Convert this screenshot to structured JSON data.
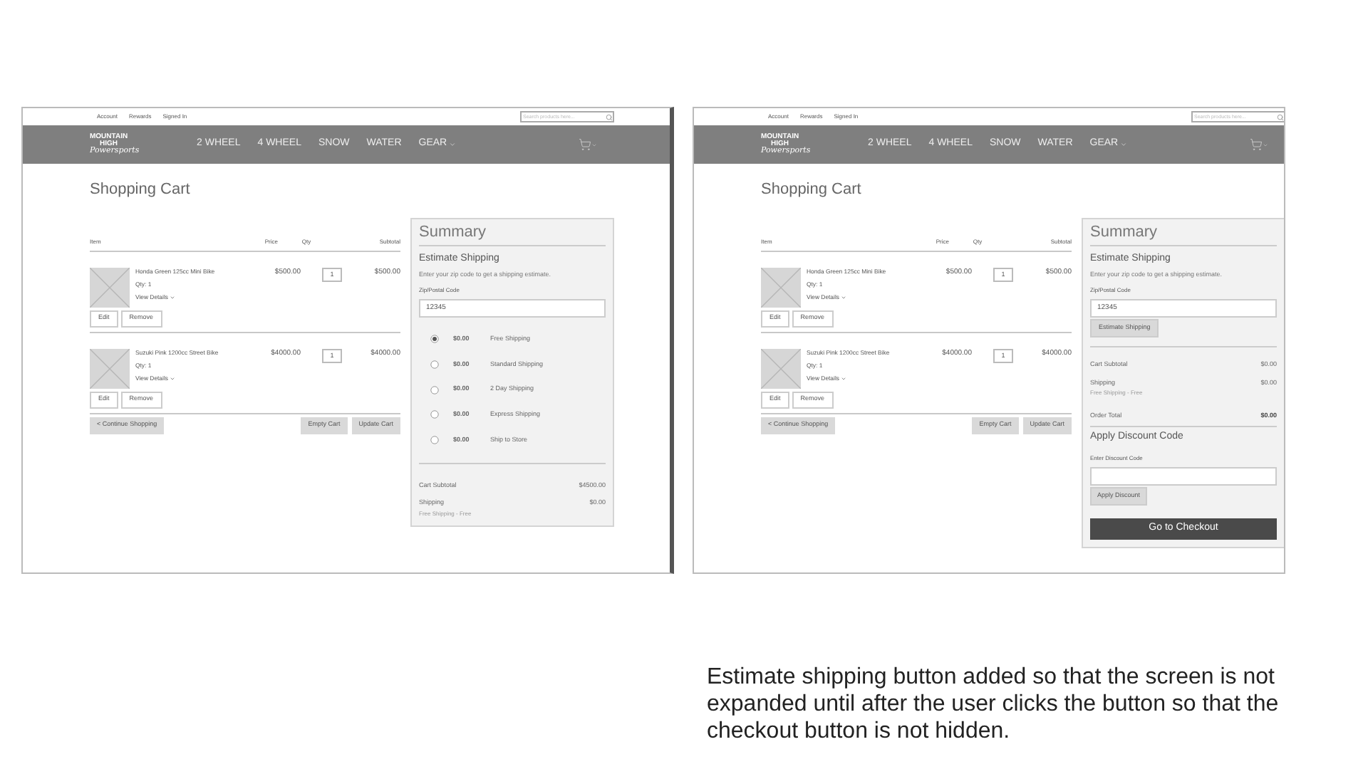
{
  "screens": [
    {
      "top_links": [
        "Account",
        "Rewards",
        "Signed In"
      ],
      "search": {
        "placeholder": "Search products here..."
      },
      "logo": [
        "MOUNTAIN",
        "HIGH",
        "Powersports"
      ],
      "nav": [
        {
          "label": "2 WHEEL",
          "dropdown": false
        },
        {
          "label": "4 WHEEL",
          "dropdown": false
        },
        {
          "label": "SNOW",
          "dropdown": false
        },
        {
          "label": "WATER",
          "dropdown": false
        },
        {
          "label": "GEAR",
          "dropdown": true
        }
      ],
      "page_title": "Shopping Cart",
      "columns": [
        "Item",
        "Price",
        "Qty",
        "Subtotal"
      ],
      "rows": [
        {
          "name": "Honda Green 125cc Mini Bike",
          "price": "$500.00",
          "qty": "1",
          "subtotal": "$500.00",
          "qty_line": "Qty: 1",
          "details": "View Details",
          "buttons": [
            "Edit",
            "Remove"
          ]
        },
        {
          "name": "Suzuki Pink 1200cc Street Bike",
          "price": "$4000.00",
          "qty": "1",
          "subtotal": "$4000.00",
          "qty_line": "Qty: 1",
          "details": "View Details",
          "buttons": [
            "Edit",
            "Remove"
          ]
        }
      ],
      "cart_buttons": [
        "< Continue Shopping",
        "Empty Cart",
        "Update Cart"
      ],
      "summary": {
        "kind": "options",
        "title": "Summary",
        "section": "Estimate Shipping",
        "hint": "Enter your zip code to get a shipping estimate.",
        "zip_label": "Zip/Postal Code",
        "zip_value": "12345",
        "options": [
          {
            "price": "$0.00",
            "label": "Free Shipping",
            "selected": true
          },
          {
            "price": "$0.00",
            "label": "Standard Shipping",
            "selected": false
          },
          {
            "price": "$0.00",
            "label": "2 Day Shipping",
            "selected": false
          },
          {
            "price": "$0.00",
            "label": "Express Shipping",
            "selected": false
          },
          {
            "price": "$0.00",
            "label": "Ship to Store",
            "selected": false
          }
        ],
        "totals": [
          {
            "kind": "line",
            "label": "Cart Subtotal",
            "value": "$4500.00"
          },
          {
            "kind": "line",
            "label": "Shipping",
            "note": "Free Shipping - Free",
            "value": "$0.00"
          }
        ]
      }
    },
    {
      "top_links": [
        "Account",
        "Rewards",
        "Signed In"
      ],
      "search": {
        "placeholder": "Search products here..."
      },
      "logo": [
        "MOUNTAIN",
        "HIGH",
        "Powersports"
      ],
      "nav": [
        {
          "label": "2 WHEEL",
          "dropdown": false
        },
        {
          "label": "4 WHEEL",
          "dropdown": false
        },
        {
          "label": "SNOW",
          "dropdown": false
        },
        {
          "label": "WATER",
          "dropdown": false
        },
        {
          "label": "GEAR",
          "dropdown": true
        }
      ],
      "page_title": "Shopping Cart",
      "columns": [
        "Item",
        "Price",
        "Qty",
        "Subtotal"
      ],
      "rows": [
        {
          "name": "Honda Green 125cc Mini Bike",
          "price": "$500.00",
          "qty": "1",
          "subtotal": "$500.00",
          "qty_line": "Qty: 1",
          "details": "View Details",
          "buttons": [
            "Edit",
            "Remove"
          ]
        },
        {
          "name": "Suzuki Pink 1200cc Street Bike",
          "price": "$4000.00",
          "qty": "1",
          "subtotal": "$4000.00",
          "qty_line": "Qty: 1",
          "details": "View Details",
          "buttons": [
            "Edit",
            "Remove"
          ]
        }
      ],
      "cart_buttons": [
        "< Continue Shopping",
        "Empty Cart",
        "Update Cart"
      ],
      "summary": {
        "kind": "estimate",
        "title": "Summary",
        "section": "Estimate Shipping",
        "hint": "Enter your zip code to get a shipping estimate.",
        "zip_label": "Zip/Postal Code",
        "zip_value": "12345",
        "estimate_button": "Estimate Shipping",
        "totals": [
          {
            "kind": "line",
            "label": "Cart Subtotal",
            "value": "$0.00"
          },
          {
            "kind": "line",
            "label": "Shipping",
            "note": "Free Shipping - Free",
            "value": "$0.00"
          },
          {
            "kind": "total",
            "label": "Order Total",
            "value": "$0.00"
          }
        ],
        "discount": {
          "title": "Apply Discount Code",
          "label": "Enter Discount Code",
          "button": "Apply Discount"
        },
        "checkout": "Go to Checkout"
      }
    }
  ],
  "caption": "Estimate shipping button added so that the screen is not expanded until after the user clicks the button so that the checkout button is not hidden."
}
